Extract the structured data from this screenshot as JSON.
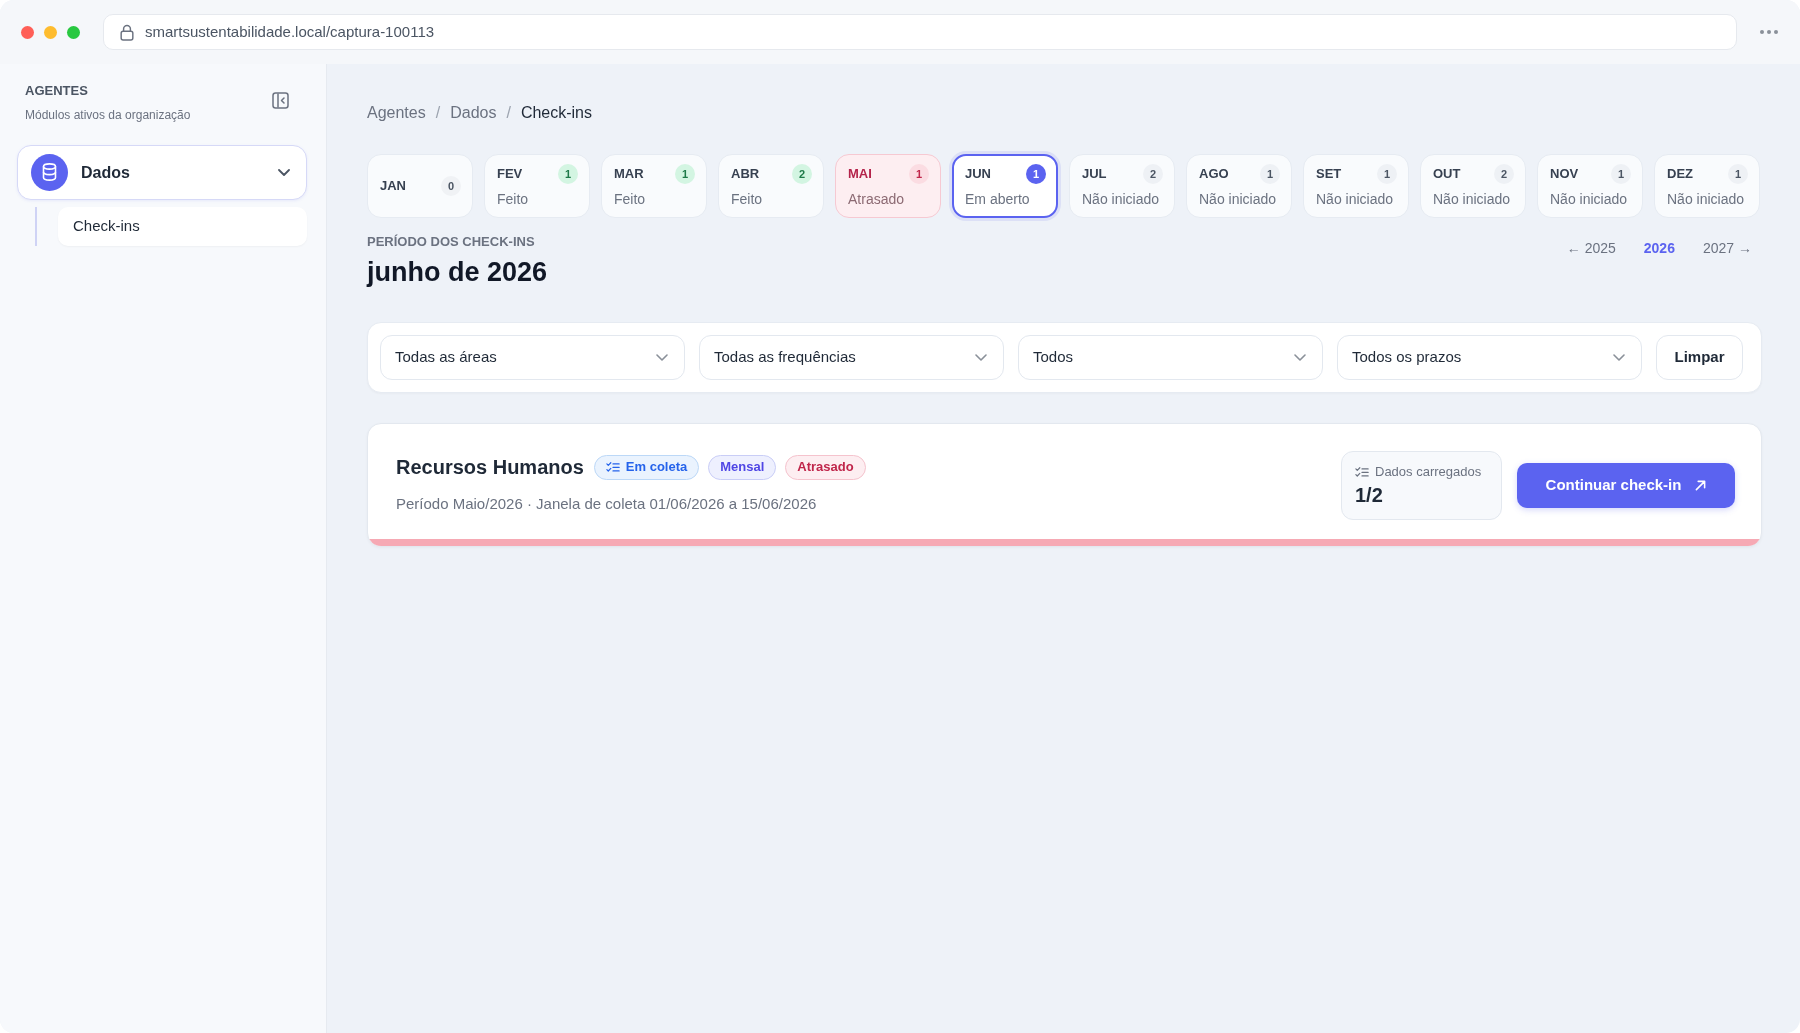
{
  "browser": {
    "url": "smartsustentabilidade.local/captura-100113"
  },
  "sidebar": {
    "title": "AGENTES",
    "subtitle": "Módulos ativos da organização",
    "nav": [
      {
        "label": "Dados",
        "expanded": true,
        "children": [
          {
            "label": "Check-ins",
            "selected": true
          }
        ]
      }
    ]
  },
  "breadcrumb": [
    {
      "label": "Agentes",
      "kind": "link"
    },
    {
      "label": "/",
      "kind": "separator"
    },
    {
      "label": "Dados",
      "kind": "link"
    },
    {
      "label": "/",
      "kind": "separator"
    },
    {
      "label": "Check-ins",
      "kind": "current"
    }
  ],
  "months": [
    {
      "label": "JAN",
      "count": "0",
      "kind": "empty",
      "selected": false
    },
    {
      "label": "FEV",
      "count": "1",
      "status": "Feito",
      "kind": "done",
      "selected": false
    },
    {
      "label": "MAR",
      "count": "1",
      "status": "Feito",
      "kind": "done",
      "selected": false
    },
    {
      "label": "ABR",
      "count": "2",
      "status": "Feito",
      "kind": "done",
      "selected": false
    },
    {
      "label": "MAI",
      "count": "1",
      "status": "Atrasado",
      "kind": "late",
      "selected": false
    },
    {
      "label": "JUN",
      "count": "1",
      "status": "Em aberto",
      "kind": "open",
      "selected": true
    },
    {
      "label": "JUL",
      "count": "2",
      "status": "Não iniciado",
      "kind": "pending",
      "selected": false
    },
    {
      "label": "AGO",
      "count": "1",
      "status": "Não iniciado",
      "kind": "pending",
      "selected": false
    },
    {
      "label": "SET",
      "count": "1",
      "status": "Não iniciado",
      "kind": "pending",
      "selected": false
    },
    {
      "label": "OUT",
      "count": "2",
      "status": "Não iniciado",
      "kind": "pending",
      "selected": false
    },
    {
      "label": "NOV",
      "count": "1",
      "status": "Não iniciado",
      "kind": "pending",
      "selected": false
    },
    {
      "label": "DEZ",
      "count": "1",
      "status": "Não iniciado",
      "kind": "pending",
      "selected": false
    }
  ],
  "period": {
    "eyebrow": "PERÍODO DOS CHECK-INS",
    "title": "junho de 2026"
  },
  "years": [
    {
      "label": "← 2025",
      "selected": false
    },
    {
      "label": "2026",
      "selected": true
    },
    {
      "label": "2027 →",
      "selected": false
    }
  ],
  "filters": {
    "dropdowns": [
      {
        "value": "Todas as áreas"
      },
      {
        "value": "Todas as frequências"
      },
      {
        "value": "Todos"
      },
      {
        "value": "Todos os prazos"
      }
    ],
    "clear_button": "Limpar"
  },
  "checkins": [
    {
      "title": "Recursos Humanos",
      "kind": "late",
      "tags": [
        {
          "label": "Em coleta",
          "kind": "collecting"
        },
        {
          "label": "Mensal",
          "kind": "frequency"
        },
        {
          "label": "Atrasado",
          "kind": "late"
        }
      ],
      "subtitle": "Período Maio/2026 · Janela de coleta 01/06/2026 a 15/06/2026",
      "loaded": {
        "label": "Dados carregados",
        "value": "1/2"
      },
      "button": "Continuar check-in"
    }
  ]
}
